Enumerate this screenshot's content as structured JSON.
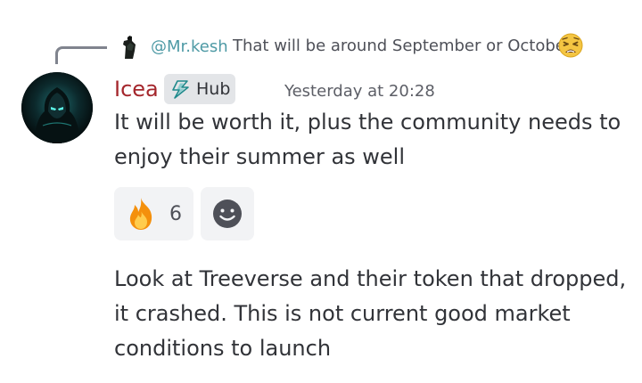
{
  "reply": {
    "mention": "@Mr.kesh",
    "text": "That will be around September or October",
    "emoji": "weary-face-icon"
  },
  "message": {
    "author": "Icea",
    "author_color": "#a4262c",
    "role_tag": "Hub",
    "role_icon": "lightning-icon",
    "timestamp": "Yesterday at 20:28",
    "paragraphs": [
      "It will be worth it, plus the community needs to enjoy their summer as well",
      "Look at Treeverse and their token that dropped, it crashed. This is not current good market conditions to launch"
    ]
  },
  "reactions": [
    {
      "emoji": "fire-icon",
      "count": "6"
    },
    {
      "emoji": "add-reaction-icon"
    }
  ],
  "colors": {
    "mention": "#4e9aa5",
    "background": "#ffffff",
    "reaction_bg": "#f2f3f5"
  }
}
